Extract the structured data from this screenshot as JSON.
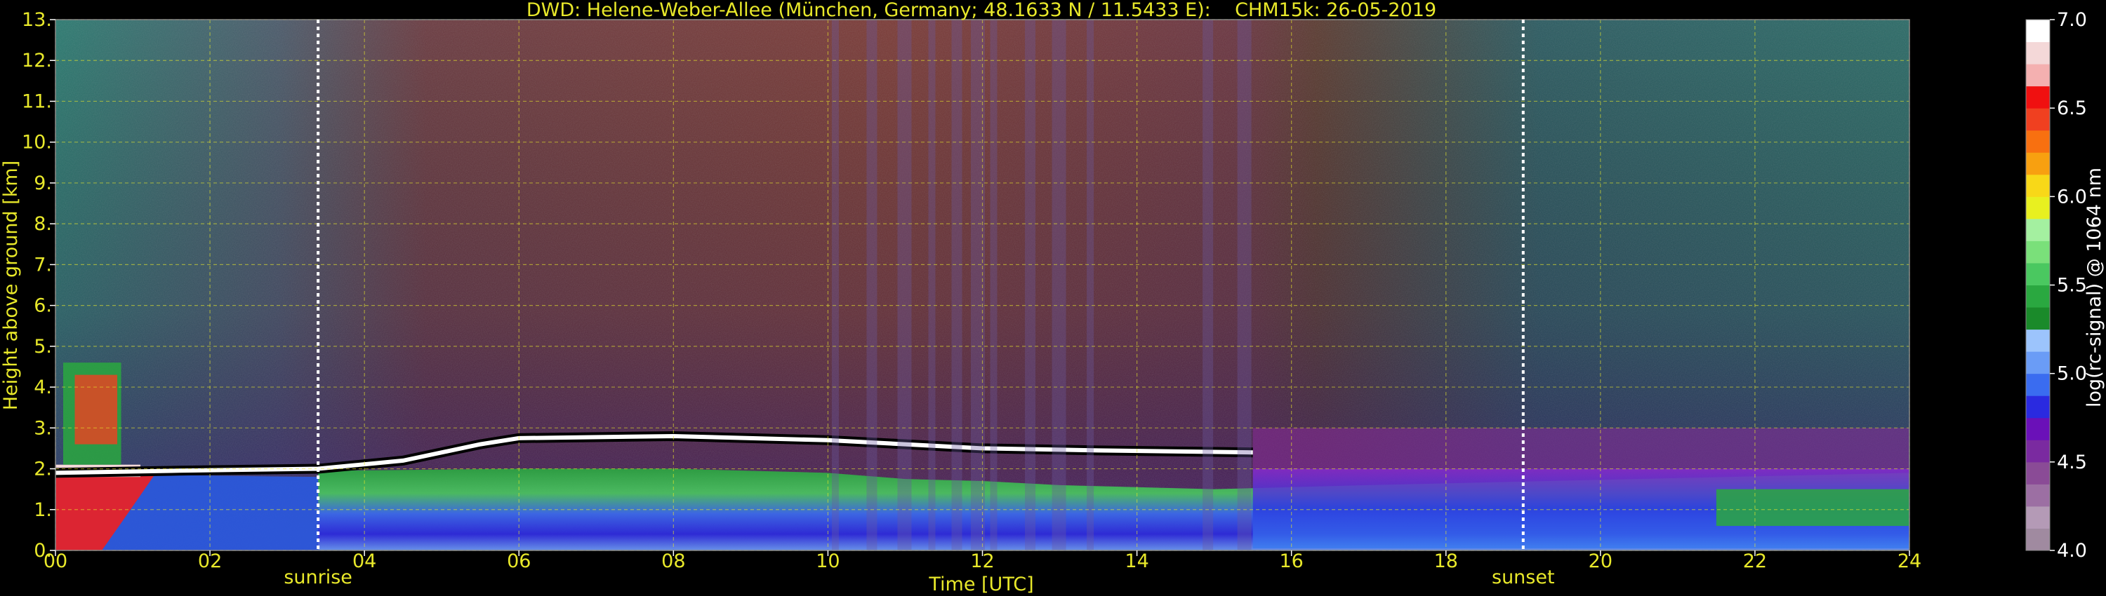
{
  "chart_data": {
    "type": "heatmap",
    "title": "DWD: Helene-Weber-Allee (München, Germany; 48.1633 N / 11.5433 E):    CHM15k: 26-05-2019",
    "xlabel": "Time [UTC]",
    "ylabel": "Height above ground [km]",
    "xlim": [
      0,
      24
    ],
    "ylim": [
      0,
      13
    ],
    "x_ticks": [
      "00",
      "02",
      "04",
      "06",
      "08",
      "10",
      "12",
      "14",
      "16",
      "18",
      "20",
      "22",
      "24"
    ],
    "y_ticks": [
      "0.",
      "1.",
      "2.",
      "3.",
      "4.",
      "5.",
      "6.",
      "7.",
      "8.",
      "9.",
      "10.",
      "11.",
      "12.",
      "13."
    ],
    "grid": true,
    "annotations": [
      {
        "text": "sunrise",
        "x": 3.4
      },
      {
        "text": "sunset",
        "x": 19.0
      }
    ],
    "colorbar": {
      "label": "log(rc-signal) @ 1064 nm",
      "range": [
        4.0,
        7.0
      ],
      "ticks": [
        "4.0",
        "4.5",
        "5.0",
        "5.5",
        "6.0",
        "6.5",
        "7.0"
      ],
      "colors": [
        "#a08aa0",
        "#b49ab6",
        "#9c6fa3",
        "#8a4b96",
        "#7a2aa0",
        "#6a10b8",
        "#2a2ae0",
        "#3a6cf0",
        "#6a9cf6",
        "#9cc4fc",
        "#1a8a2a",
        "#2aa840",
        "#4ac860",
        "#7ae07a",
        "#a4f0a0",
        "#e8f020",
        "#f8d818",
        "#f8a010",
        "#f87010",
        "#f04020",
        "#f01010",
        "#f4b0b0",
        "#f4d8d8",
        "#ffffff"
      ]
    },
    "features": {
      "boundary_layer_top_km": [
        {
          "x": 0.0,
          "y": 1.9
        },
        {
          "x": 1.5,
          "y": 1.95
        },
        {
          "x": 3.4,
          "y": 2.0
        },
        {
          "x": 4.5,
          "y": 2.2
        },
        {
          "x": 5.5,
          "y": 2.6
        },
        {
          "x": 6.0,
          "y": 2.75
        },
        {
          "x": 8.0,
          "y": 2.8
        },
        {
          "x": 10.0,
          "y": 2.7
        },
        {
          "x": 12.0,
          "y": 2.5
        },
        {
          "x": 13.5,
          "y": 2.45
        },
        {
          "x": 15.5,
          "y": 2.4
        }
      ],
      "residual_layer_top_km": [
        {
          "x": 3.4,
          "y": 1.95
        },
        {
          "x": 6.0,
          "y": 2.0
        },
        {
          "x": 8.0,
          "y": 2.0
        },
        {
          "x": 10.0,
          "y": 1.9
        },
        {
          "x": 11.0,
          "y": 1.75
        },
        {
          "x": 12.0,
          "y": 1.7
        },
        {
          "x": 13.0,
          "y": 1.6
        },
        {
          "x": 15.0,
          "y": 1.5
        },
        {
          "x": 17.0,
          "y": 1.6
        },
        {
          "x": 24.0,
          "y": 1.9
        }
      ]
    }
  }
}
